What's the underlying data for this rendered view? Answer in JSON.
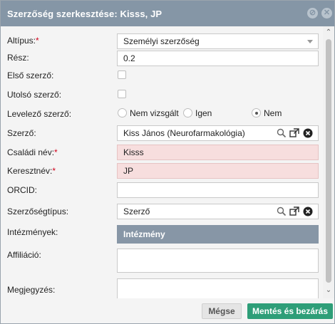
{
  "dialog": {
    "title": "Szerzőség szerkesztése: Kisss, JP",
    "colors": {
      "titlebar": "#8596a6",
      "invalid_field": "#f7dede",
      "save_button": "#2e9e78",
      "required": "#d0021b"
    }
  },
  "form": {
    "subtype": {
      "label": "Altípus:",
      "value": "Személyi szerzőség"
    },
    "share": {
      "label": "Rész:",
      "value": "0.2"
    },
    "first_author": {
      "label": "Első szerző:",
      "checked": false
    },
    "last_author": {
      "label": "Utolsó szerző:",
      "checked": false
    },
    "corresponding": {
      "label": "Levelező szerző:",
      "options": [
        "Nem vizsgált",
        "Igen",
        "Nem"
      ],
      "selected": "Nem"
    },
    "author": {
      "label": "Szerző:",
      "value": "Kiss János (Neurofarmakológia)"
    },
    "family_name": {
      "label": "Családi név:",
      "value": "Kisss"
    },
    "given_name": {
      "label": "Keresztnév:",
      "value": "JP"
    },
    "orcid": {
      "label": "ORCID:",
      "value": ""
    },
    "authorship_type": {
      "label": "Szerzőségtípus:",
      "value": "Szerző"
    },
    "institutions": {
      "label": "Intézmények:",
      "header": "Intézmény"
    },
    "affiliation": {
      "label": "Affiliáció:",
      "value": ""
    },
    "note": {
      "label": "Megjegyzés:",
      "value": ""
    },
    "required_mark": "*"
  },
  "footer": {
    "cancel_label": "Mégse",
    "save_label": "Mentés és bezárás"
  }
}
